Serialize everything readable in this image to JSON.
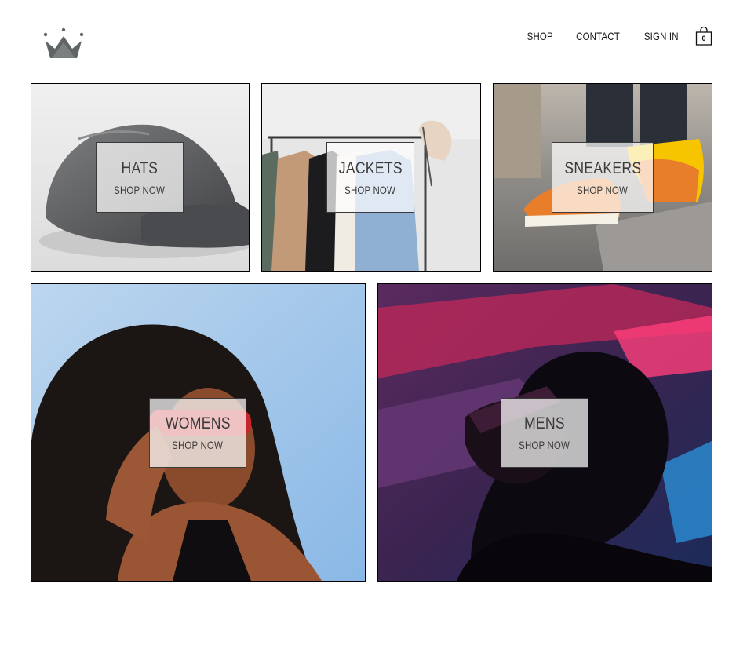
{
  "header": {
    "logo_icon": "crown-icon",
    "nav": {
      "shop": "SHOP",
      "contact": "CONTACT",
      "sign_in": "SIGN IN"
    },
    "cart": {
      "icon": "shopping-bag-icon",
      "count": "0"
    }
  },
  "categories": [
    {
      "title": "HATS",
      "cta": "SHOP NOW"
    },
    {
      "title": "JACKETS",
      "cta": "SHOP NOW"
    },
    {
      "title": "SNEAKERS",
      "cta": "SHOP NOW"
    },
    {
      "title": "WOMENS",
      "cta": "SHOP NOW"
    },
    {
      "title": "MENS",
      "cta": "SHOP NOW"
    }
  ],
  "colors": {
    "background": "#ffffff",
    "border": "#000000",
    "logo": "#5f6466",
    "label_text": "#3b3b3b"
  }
}
